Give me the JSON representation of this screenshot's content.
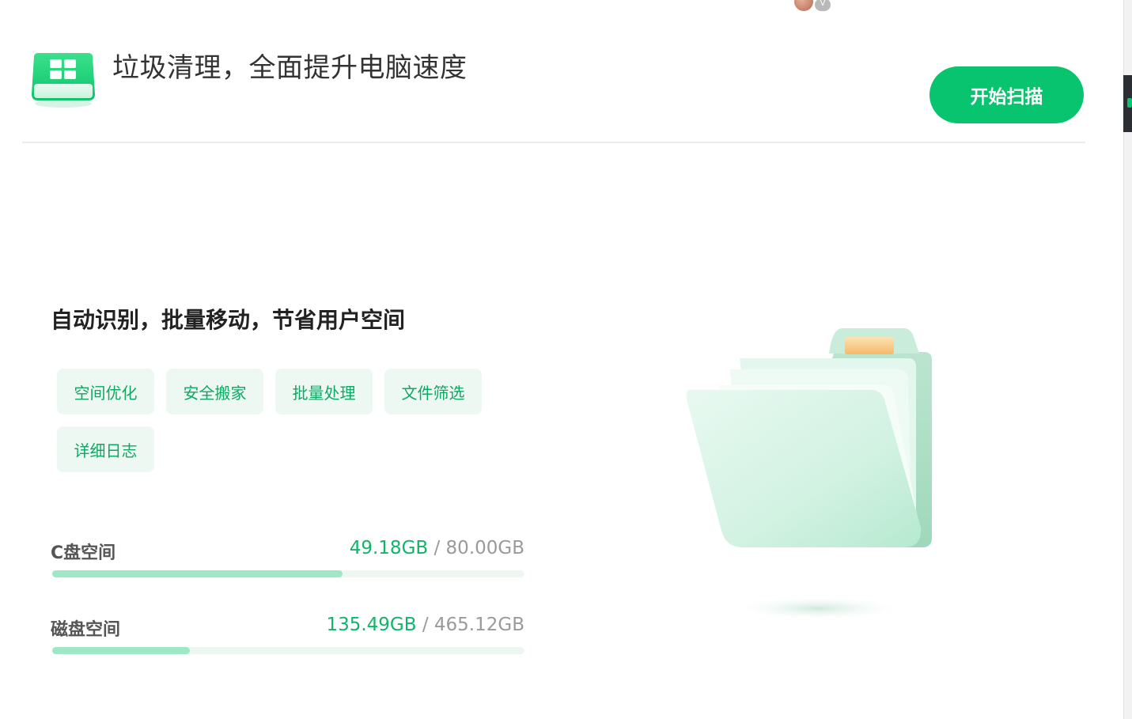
{
  "header": {
    "title": "垃圾清理，全面提升电脑速度",
    "scan_button_label": "开始扫描",
    "avatar_badge": "V"
  },
  "intro": {
    "heading": "自动识别，批量移动，节省用户空间"
  },
  "tags": [
    "空间优化",
    "安全搬家",
    "批量处理",
    "文件筛选",
    "详细日志"
  ],
  "disks": [
    {
      "label": "C盘空间",
      "used": "49.18GB",
      "separator": "/",
      "total": "80.00GB",
      "usage_fraction": 0.615
    },
    {
      "label": "磁盘空间",
      "used": "135.49GB",
      "separator": "/",
      "total": "465.12GB",
      "usage_fraction": 0.291
    }
  ],
  "colors": {
    "accent": "#08c46e",
    "accent_text": "#10b569",
    "tag_bg": "#eef8f3",
    "bar_fill": "#9ee8c5",
    "bar_track": "#eef6f2"
  },
  "icons": {
    "logo": "disk-cleanup-logo-icon",
    "illustration": "folder-icon"
  }
}
